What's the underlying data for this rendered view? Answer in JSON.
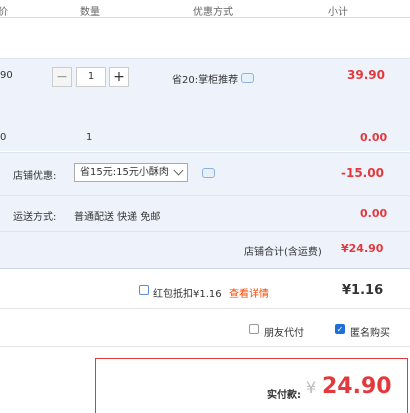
{
  "header": {
    "col_price": "价",
    "col_qty": "数量",
    "col_discount": "优惠方式",
    "col_subtotal": "小计"
  },
  "item": {
    "price_fragment": "90",
    "qty_minus": "−",
    "qty_value": "1",
    "qty_plus": "+",
    "promo_text": "省20:掌柜推荐",
    "subtotal": "39.90"
  },
  "summary_row": {
    "price_fragment": "0",
    "qty": "1",
    "amount": "0.00"
  },
  "shop_discount": {
    "label": "店铺优惠:",
    "selected_option": "省15元:15元小酥肉",
    "amount": "-15.00"
  },
  "shipping": {
    "label": "运送方式:",
    "method": "普通配送 快递 免邮",
    "amount": "0.00"
  },
  "shop_total": {
    "label": "店铺合计(含运费)",
    "amount": "¥24.90"
  },
  "red_packet": {
    "label": "红包抵扣¥1.16",
    "link": "查看详情",
    "amount": "¥1.16"
  },
  "options": {
    "friend_pay": "朋友代付",
    "anonymous": "匿名购买",
    "check_mark": "✓"
  },
  "payment": {
    "label": "实付款:",
    "currency": "¥",
    "amount": "24.90"
  },
  "colors": {
    "accent_red": "#e4393c",
    "band_blue": "#eef3fb",
    "link_orange": "#f40"
  }
}
